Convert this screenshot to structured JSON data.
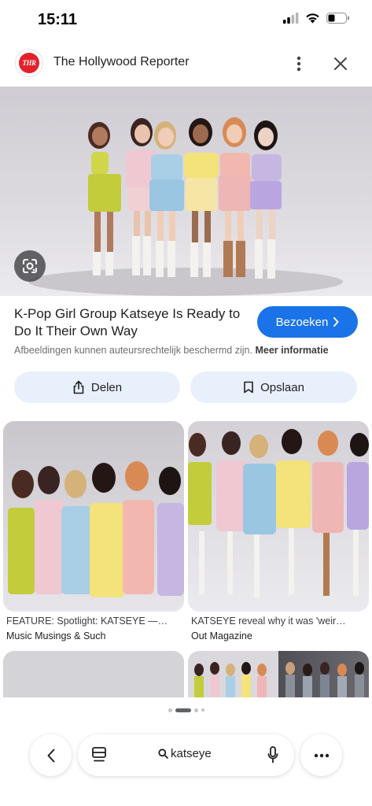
{
  "status_bar": {
    "time": "15:11",
    "icons": [
      "signal-icon",
      "wifi-icon",
      "battery-icon"
    ]
  },
  "header": {
    "site_logo_text": "THR",
    "site_name": "The Hollywood Reporter",
    "icons": [
      "more-vert-icon",
      "close-icon"
    ]
  },
  "hero": {
    "image_description": "photo",
    "lens_icon": "google-lens-icon"
  },
  "result": {
    "title": "K-Pop Girl Group Katseye Is Ready to Do It Their Own Way",
    "visit_button": "Bezoeken",
    "copyright_text": "Afbeeldingen kunnen auteursrechtelijk beschermd zijn.",
    "more_info_link": "Meer informatie"
  },
  "actions": {
    "share_label": "Delen",
    "save_label": "Opslaan"
  },
  "related": [
    {
      "caption": "FEATURE: Spotlight: KATSEYE —…",
      "source": "Music Musings & Such"
    },
    {
      "caption": "KATSEYE reveal why it was 'weir…",
      "source": "Out Magazine"
    }
  ],
  "bottom_bar": {
    "search_query": "katseye"
  },
  "colors": {
    "accent": "#1a73e8",
    "chip_bg": "#e8f0fb",
    "thr_red": "#e4202a"
  }
}
